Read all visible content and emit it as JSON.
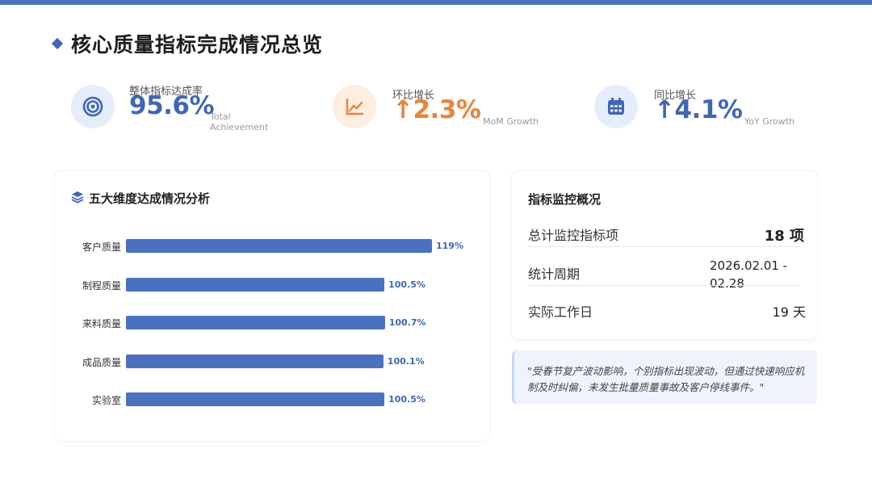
{
  "page": {
    "title": "核心质量指标完成情况总览"
  },
  "kpis": [
    {
      "label": "整体指标达成率",
      "value": "95.6%",
      "sub": "Total Achievement",
      "icon": "target-icon"
    },
    {
      "label": "环比增长",
      "value": "↑2.3%",
      "sub": "MoM Growth",
      "icon": "line-chart-icon"
    },
    {
      "label": "同比增长",
      "value": "↑4.1%",
      "sub": "YoY Growth",
      "icon": "calendar-icon"
    }
  ],
  "chart_panel": {
    "title": "五大维度达成情况分析",
    "icon": "layers-icon"
  },
  "chart_data": {
    "type": "bar",
    "orientation": "horizontal",
    "title": "五大维度达成情况分析",
    "categories": [
      "客户质量",
      "制程质量",
      "来料质量",
      "成品质量",
      "实验室"
    ],
    "values": [
      119,
      100.5,
      100.7,
      100.1,
      100.5
    ],
    "value_labels": [
      "119%",
      "100.5%",
      "100.7%",
      "100.1%",
      "100.5%"
    ],
    "xlim": [
      0,
      119
    ],
    "grid": false,
    "color": "#4a70c0"
  },
  "monitor": {
    "title": "指标监控概况",
    "rows": [
      {
        "label": "总计监控指标项",
        "value": "18 项"
      },
      {
        "label": "统计周期",
        "value_line1": "2026.02.01 -",
        "value_line2": "02.28"
      },
      {
        "label": "实际工作日",
        "value": "19 天"
      }
    ]
  },
  "note": {
    "text": "\"受春节复产波动影响，个别指标出现波动，但通过快速响应机制及时纠偏，未发生批量质量事故及客户停线事件。\""
  },
  "colors": {
    "accent": "#4a70c0",
    "orange": "#e8843a",
    "blue_text": "#3f66b8"
  }
}
